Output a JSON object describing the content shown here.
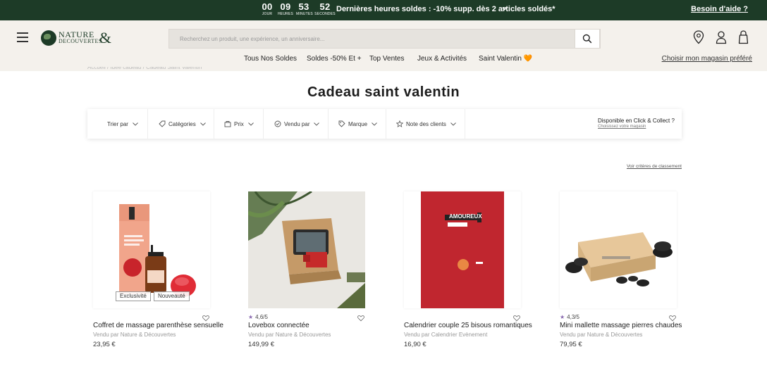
{
  "promo": {
    "countdown": [
      {
        "value": "00",
        "label": "Jour"
      },
      {
        "value": "09",
        "label": "Heures"
      },
      {
        "value": "53",
        "label": "Minutes"
      },
      {
        "value": "52",
        "label": "Secondes"
      }
    ],
    "text": "Dernières heures soldes : -10% supp. dès 2 articles soldés*",
    "help": "Besoin d'aide ?",
    "bg_color": "#1d3b27"
  },
  "header": {
    "logo_line1": "NATURE",
    "logo_line2": "DECOUVERTES",
    "logo_amp": "&",
    "search_placeholder": "Recherchez un produit, une expérience, un anniversaire...",
    "icons": [
      "menu-icon",
      "search-icon",
      "location-pin-icon",
      "user-icon",
      "bag-icon"
    ]
  },
  "nav": {
    "items": [
      "Tous Nos Soldes",
      "Soldes -50% Et +",
      "Top Ventes",
      "Jeux & Activités",
      "Saint Valentin 🧡"
    ],
    "store_link": "Choisir mon magasin préféré"
  },
  "breadcrumb": "Accueil / Idée cadeau / Cadeau Saint Valentin",
  "page_title": "Cadeau saint valentin",
  "filters": {
    "items": [
      {
        "label": "Trier par",
        "icon": ""
      },
      {
        "label": "Catégories",
        "icon": "tag-icon"
      },
      {
        "label": "Prix",
        "icon": "price-icon"
      },
      {
        "label": "Vendu par",
        "icon": "seller-icon"
      },
      {
        "label": "Marque",
        "icon": "brand-tag-icon"
      },
      {
        "label": "Note des clients",
        "icon": "star-icon"
      }
    ],
    "click_collect": "Disponible en Click & Collect ?",
    "click_collect_sub": "Choisissez votre magasin"
  },
  "criteria_link": "Voir critères de classement",
  "products": [
    {
      "name": "Coffret de massage parenthèse sensuelle",
      "seller": "Vendu par Nature & Découvertes",
      "price": "23,95 €",
      "rating": "",
      "badges": [
        "Exclusivité",
        "Nouveauté"
      ]
    },
    {
      "name": "Lovebox connectée",
      "seller": "Vendu par Nature & Découvertes",
      "price": "149,99 €",
      "rating": "4,6/5",
      "badges": []
    },
    {
      "name": "Calendrier couple 25 bisous romantiques",
      "seller": "Vendu par Calendrier Evènement",
      "price": "16,90 €",
      "rating": "",
      "badges": [],
      "image_text": "AMOUREUX"
    },
    {
      "name": "Mini mallette massage pierres chaudes",
      "seller": "Vendu par Nature & Découvertes",
      "price": "79,95 €",
      "rating": "4,3/5",
      "badges": []
    }
  ]
}
